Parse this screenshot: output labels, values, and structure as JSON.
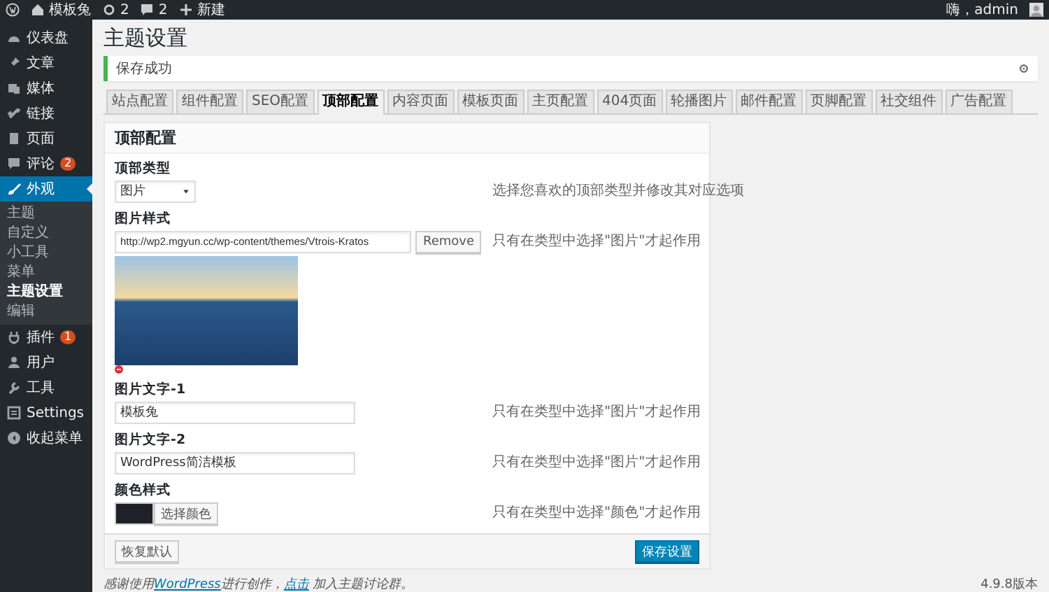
{
  "admin_bar": {
    "site": "模板兔",
    "updates": "2",
    "comments": "2",
    "new": "新建",
    "greeting": "嗨，admin"
  },
  "menu": [
    {
      "label": "仪表盘",
      "selected": false
    },
    {
      "label": "文章",
      "selected": false
    },
    {
      "label": "媒体",
      "selected": false
    },
    {
      "label": "链接",
      "selected": false
    },
    {
      "label": "页面",
      "selected": false
    },
    {
      "label": "评论",
      "badge": "2",
      "selected": false
    },
    {
      "label": "外观",
      "selected": true,
      "children": [
        {
          "label": "主题",
          "selected": false
        },
        {
          "label": "自定义",
          "selected": false
        },
        {
          "label": "小工具",
          "selected": false
        },
        {
          "label": "菜单",
          "selected": false
        },
        {
          "label": "主题设置",
          "selected": true
        },
        {
          "label": "编辑",
          "selected": false
        }
      ]
    },
    {
      "label": "插件",
      "badge": "1",
      "selected": false
    },
    {
      "label": "用户",
      "selected": false
    },
    {
      "label": "工具",
      "selected": false
    },
    {
      "label": "Settings",
      "selected": false
    },
    {
      "label": "收起菜单",
      "selected": false
    }
  ],
  "page_title": "主题设置",
  "notice": "保存成功",
  "tabs": [
    {
      "label": "站点配置",
      "selected": false
    },
    {
      "label": "组件配置",
      "selected": false
    },
    {
      "label": "SEO配置",
      "selected": false
    },
    {
      "label": "顶部配置",
      "selected": true
    },
    {
      "label": "内容页面",
      "selected": false
    },
    {
      "label": "模板页面",
      "selected": false
    },
    {
      "label": "主页配置",
      "selected": false
    },
    {
      "label": "404页面",
      "selected": false
    },
    {
      "label": "轮播图片",
      "selected": false
    },
    {
      "label": "邮件配置",
      "selected": false
    },
    {
      "label": "页脚配置",
      "selected": false
    },
    {
      "label": "社交组件",
      "selected": false
    },
    {
      "label": "广告配置",
      "selected": false
    }
  ],
  "panel": {
    "heading": "顶部配置",
    "fields": [
      {
        "kind": "select",
        "label": "顶部类型",
        "value": "图片",
        "description": "选择您喜欢的顶部类型并修改其对应选项"
      },
      {
        "kind": "image",
        "label": "图片样式",
        "value": "http://wp2.mgyun.cc/wp-content/themes/Vtrois-Kratos",
        "button": "Remove",
        "description": "只有在类型中选择\"图片\"才起作用"
      },
      {
        "kind": "text",
        "label": "图片文字-1",
        "value": "模板兔",
        "description": "只有在类型中选择\"图片\"才起作用"
      },
      {
        "kind": "text",
        "label": "图片文字-2",
        "value": "WordPress简洁模板",
        "description": "只有在类型中选择\"图片\"才起作用"
      },
      {
        "kind": "color",
        "label": "颜色样式",
        "color": "#1e2228",
        "button": "选择颜色",
        "description": "只有在类型中选择\"颜色\"才起作用"
      }
    ],
    "reset_button": "恢复默认",
    "save_button": "保存设置"
  },
  "footer": {
    "parts": [
      {
        "text": "感谢使用",
        "link": false
      },
      {
        "text": "WordPress",
        "link": true
      },
      {
        "text": "进行创作，",
        "link": false
      },
      {
        "text": "点击",
        "link": true
      },
      {
        "text": " 加入主题讨论群。",
        "link": false
      }
    ],
    "version": "4.9.8版本"
  }
}
